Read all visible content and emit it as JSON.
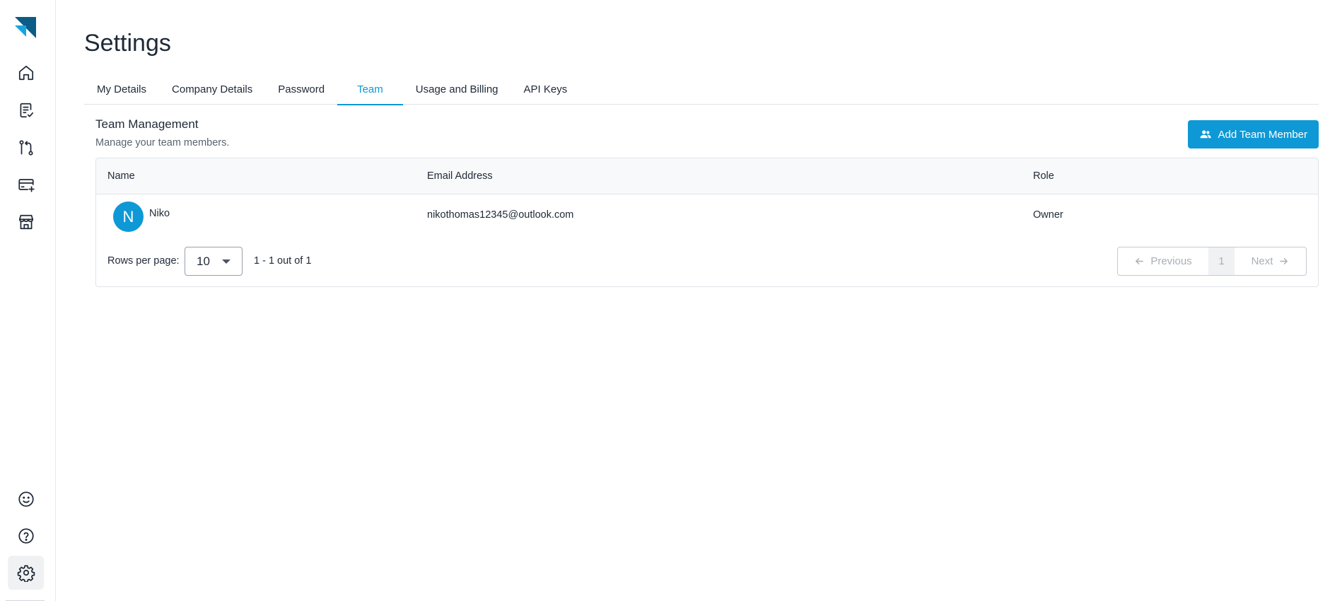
{
  "colors": {
    "accent": "#0e98d6",
    "logo_dark": "#0b5c86",
    "logo_light": "#1aa3e0"
  },
  "sidebar": {
    "logo": "brand-logo",
    "items": [
      {
        "name": "home",
        "icon": "home-icon"
      },
      {
        "name": "tasks",
        "icon": "checklist-icon"
      },
      {
        "name": "workflows",
        "icon": "route-icon"
      },
      {
        "name": "billing",
        "icon": "card-add-icon"
      },
      {
        "name": "store",
        "icon": "store-icon"
      }
    ],
    "bottom_items": [
      {
        "name": "feedback",
        "icon": "smiley-icon"
      },
      {
        "name": "help",
        "icon": "help-icon"
      },
      {
        "name": "settings",
        "icon": "gear-icon",
        "active": true
      }
    ]
  },
  "page": {
    "title": "Settings",
    "tabs": [
      {
        "label": "My Details",
        "active": false
      },
      {
        "label": "Company Details",
        "active": false
      },
      {
        "label": "Password",
        "active": false
      },
      {
        "label": "Team",
        "active": true
      },
      {
        "label": "Usage and Billing",
        "active": false
      },
      {
        "label": "API Keys",
        "active": false
      }
    ]
  },
  "team": {
    "title": "Team Management",
    "subtitle": "Manage your team members.",
    "add_button_label": "Add Team Member",
    "table": {
      "columns": [
        "Name",
        "Email Address",
        "Role"
      ],
      "rows": [
        {
          "initial": "N",
          "name": "Niko",
          "email": "nikothomas12345@outlook.com",
          "role": "Owner"
        }
      ]
    },
    "pagination": {
      "rows_per_page_label": "Rows per page:",
      "rows_per_page_value": "10",
      "range_text": "1 - 1 out of 1",
      "previous_label": "Previous",
      "current_page": "1",
      "next_label": "Next"
    }
  }
}
